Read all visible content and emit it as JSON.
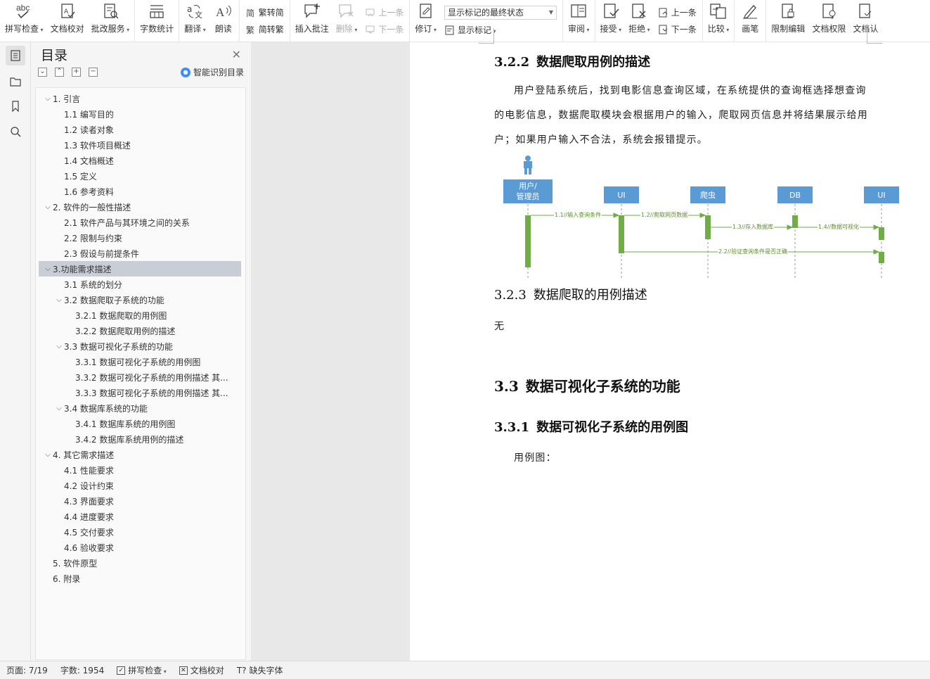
{
  "ribbon": {
    "spell_check": "拼写检查",
    "doc_proofread": "文档校对",
    "correction_service": "批改服务",
    "word_count": "字数统计",
    "translate": "翻译",
    "read_aloud": "朗读",
    "trad_to_simp": "繁转简",
    "simp_to_trad": "简转繁",
    "insert_comment": "插入批注",
    "delete": "删除",
    "prev_comment": "上一条",
    "next_comment": "下一条",
    "revise": "修订",
    "markup_select_value": "显示标记的最终状态",
    "show_markup": "显示标记",
    "review": "审阅",
    "accept": "接受",
    "reject": "拒绝",
    "prev_change": "上一条",
    "next_change": "下一条",
    "compare": "比较",
    "ink": "画笔",
    "restrict_edit": "限制编辑",
    "doc_permission": "文档权限",
    "doc_cert": "文档认"
  },
  "toc": {
    "title": "目录",
    "smart_label": "智能识别目录",
    "items": [
      {
        "label": "1. 引言",
        "level": 1,
        "arrow": "v"
      },
      {
        "label": "1.1  编写目的",
        "level": 2,
        "arrow": ""
      },
      {
        "label": "1.2  读者对象",
        "level": 2,
        "arrow": ""
      },
      {
        "label": "1.3  软件项目概述",
        "level": 2,
        "arrow": ""
      },
      {
        "label": "1.4  文档概述",
        "level": 2,
        "arrow": ""
      },
      {
        "label": "1.5  定义",
        "level": 2,
        "arrow": ""
      },
      {
        "label": "1.6  参考资料",
        "level": 2,
        "arrow": ""
      },
      {
        "label": "2. 软件的一般性描述",
        "level": 1,
        "arrow": "v"
      },
      {
        "label": "2.1 软件产品与其环境之间的关系",
        "level": 2,
        "arrow": ""
      },
      {
        "label": "2.2 限制与约束",
        "level": 2,
        "arrow": ""
      },
      {
        "label": "2.3 假设与前提条件",
        "level": 2,
        "arrow": ""
      },
      {
        "label": "3.功能需求描述",
        "level": 1,
        "arrow": "v",
        "selected": true
      },
      {
        "label": "3.1 系统的划分",
        "level": 2,
        "arrow": ""
      },
      {
        "label": "3.2 数据爬取子系统的功能",
        "level": 2,
        "arrow": "v"
      },
      {
        "label": "3.2.1  数据爬取的用例图",
        "level": 3,
        "arrow": ""
      },
      {
        "label": "3.2.2  数据爬取用例的描述",
        "level": 3,
        "arrow": ""
      },
      {
        "label": "3.3 数据可视化子系统的功能",
        "level": 2,
        "arrow": "v"
      },
      {
        "label": "3.3.1  数据可视化子系统的用例图",
        "level": 3,
        "arrow": ""
      },
      {
        "label": "3.3.2  数据可视化子系统的用例描述  其...",
        "level": 3,
        "arrow": ""
      },
      {
        "label": "3.3.3  数据可视化子系统的用例描述  其...",
        "level": 3,
        "arrow": ""
      },
      {
        "label": "3.4 数据库系统的功能",
        "level": 2,
        "arrow": "v"
      },
      {
        "label": "3.4.1  数据库系统的用例图",
        "level": 3,
        "arrow": ""
      },
      {
        "label": "3.4.2  数据库系统用例的描述",
        "level": 3,
        "arrow": ""
      },
      {
        "label": "4.  其它需求描述",
        "level": 1,
        "arrow": "v"
      },
      {
        "label": "4.1  性能要求",
        "level": 2,
        "arrow": ""
      },
      {
        "label": "4.2  设计约束",
        "level": 2,
        "arrow": ""
      },
      {
        "label": "4.3  界面要求",
        "level": 2,
        "arrow": ""
      },
      {
        "label": "4.4  进度要求",
        "level": 2,
        "arrow": ""
      },
      {
        "label": "4.5  交付要求",
        "level": 2,
        "arrow": ""
      },
      {
        "label": "4.6  验收要求",
        "level": 2,
        "arrow": ""
      },
      {
        "label": "5.  软件原型",
        "level": 1,
        "arrow": ""
      },
      {
        "label": "6.  附录",
        "level": 1,
        "arrow": ""
      }
    ]
  },
  "doc": {
    "h_322_num": "3.2.2",
    "h_322_text": "数据爬取用例的描述",
    "para_1_line1": "用户登陆系统后，找到电影信息查询区域，在系统提供的查询框选择想查询",
    "para_1_line2": "的电影信息，数据爬取模块会根据用户的输入，爬取网页信息并将结果展示给用",
    "para_1_line3": "户；如果用户输入不合法，系统会报错提示。",
    "diagram": {
      "actors": [
        "用户/\n管理员",
        "UI",
        "爬虫",
        "DB",
        "UI"
      ],
      "messages": [
        "1.1//输入查询条件",
        "1.2//爬取网页数据",
        "1.3//存入数据库",
        "1.4//数据可视化",
        "2.2//验证查询条件是否正确"
      ]
    },
    "h_323_num": "3.2.3",
    "h_323_text": "数据爬取的用例描述",
    "none_text": "无",
    "h_33_num": "3.3",
    "h_33_text": "数据可视化子系统的功能",
    "h_331_num": "3.3.1",
    "h_331_text": "数据可视化子系统的用例图",
    "usecase_label": "用例图："
  },
  "status": {
    "page": "页面: 7/19",
    "words": "字数: 1954",
    "spell": "拼写检查",
    "proof": "文档校对",
    "missing_font": "缺失字体"
  }
}
